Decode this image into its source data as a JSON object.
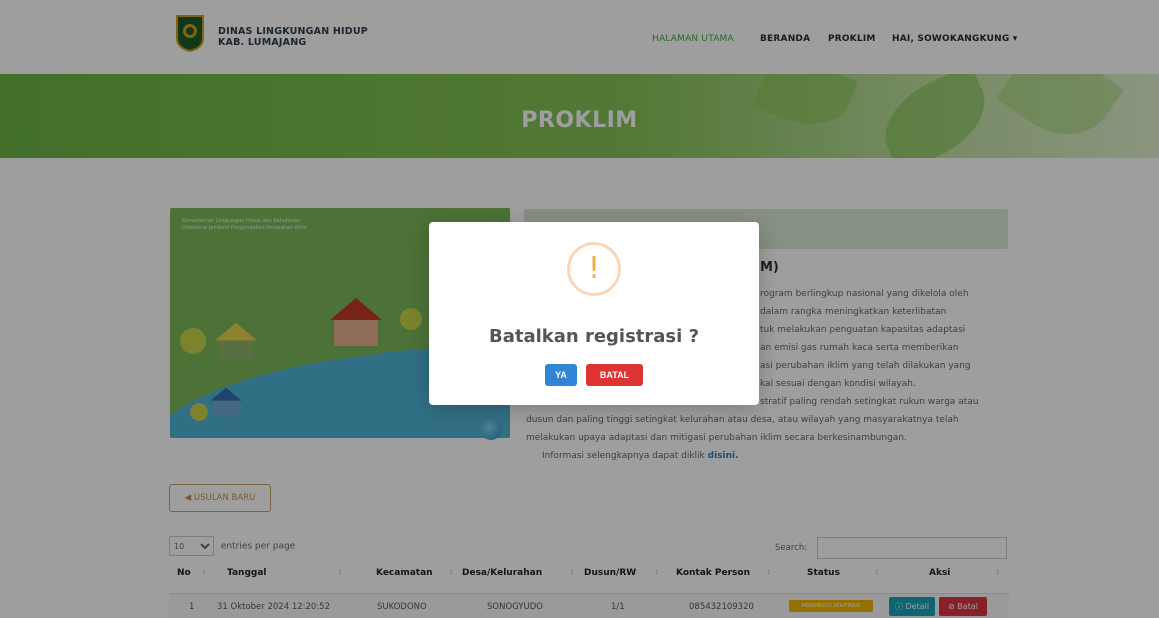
{
  "navbar": {
    "brand_line1": "DINAS LINGKUNGAN HIDUP",
    "brand_line2": "KAB. LUMAJANG",
    "items": [
      {
        "label": "HALAMAN UTAMA",
        "active": true
      },
      {
        "label": "BERANDA"
      },
      {
        "label": "PROKLIM"
      },
      {
        "label": "HAI, SOWOKANGKUNG ▾"
      }
    ]
  },
  "hero": {
    "title": "PROKLIM"
  },
  "illustration": {
    "header_line1": "Kementerian Lingkungan Hidup dan Kehutanan",
    "header_line2": "Direktorat Jenderal Pengendalian Perubahan Iklim"
  },
  "info": {
    "heading": "M)",
    "lines": [
      "rogram berlingkup nasional yang dikelola oleh",
      "dalam rangka meningkatkan keterlibatan",
      "tuk melakukan penguatan kapasitas adaptasi",
      "an emisi gas rumah kaca serta memberikan",
      "asi perubahan iklim yang telah dilakukan yang",
      "kal sesuai dengan kondisi wilayah.",
      "stratif paling rendah setingkat rukun warga atau",
      "dusun dan paling tinggi setingkat kelurahan atau desa, atau wilayah yang masyarakatnya telah",
      "melakukan upaya adaptasi dan mitigasi perubahan iklim secara berkesinambungan."
    ],
    "more_prefix": "Informasi selengkapnya dapat diklik ",
    "more_link": "disini."
  },
  "usulan_button": "◀ USULAN BARU",
  "table_controls": {
    "entries_value": "10",
    "entries_label": "entries per page",
    "search_label": "Search:"
  },
  "table": {
    "headers": [
      "No",
      "Tanggal",
      "Kecamatan",
      "Desa/Kelurahan",
      "Dusun/RW",
      "Kontak Person",
      "Status",
      "Aksi"
    ],
    "rows": [
      {
        "no": "1",
        "tanggal": "31 Oktober 2024 12:20:52",
        "kecamatan": "SUKODONO",
        "desa": "SONOGYUDO",
        "dusun": "1/1",
        "kontak": "085432109320",
        "status": "MENUNGGU VERIFIKASI",
        "detail": "Detail",
        "batal": "Batal"
      }
    ]
  },
  "modal": {
    "icon": "!",
    "title": "Batalkan registrasi ?",
    "confirm": "YA",
    "cancel": "BATAL"
  },
  "colors": {
    "accent_green": "#44a843",
    "confirm_blue": "#3085d6",
    "cancel_red": "#dd3333",
    "warning_orange": "#f0ad4e"
  }
}
